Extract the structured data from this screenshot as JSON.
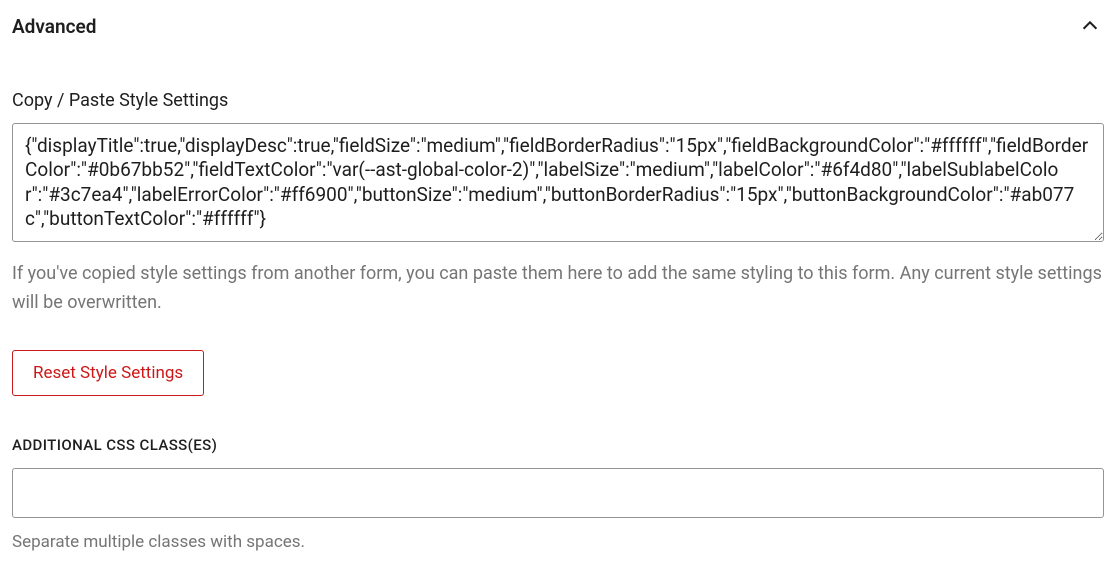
{
  "header": {
    "title": "Advanced"
  },
  "copyPaste": {
    "label": "Copy / Paste Style Settings",
    "value": "{\"displayTitle\":true,\"displayDesc\":true,\"fieldSize\":\"medium\",\"fieldBorderRadius\":\"15px\",\"fieldBackgroundColor\":\"#ffffff\",\"fieldBorderColor\":\"#0b67bb52\",\"fieldTextColor\":\"var(--ast-global-color-2)\",\"labelSize\":\"medium\",\"labelColor\":\"#6f4d80\",\"labelSublabelColor\":\"#3c7ea4\",\"labelErrorColor\":\"#ff6900\",\"buttonSize\":\"medium\",\"buttonBorderRadius\":\"15px\",\"buttonBackgroundColor\":\"#ab077c\",\"buttonTextColor\":\"#ffffff\"}",
    "help": "If you've copied style settings from another form, you can paste them here to add the same styling to this form. Any current style settings will be overwritten."
  },
  "resetButton": {
    "label": "Reset Style Settings"
  },
  "cssClasses": {
    "label": "Additional CSS Class(es)",
    "value": "",
    "help": "Separate multiple classes with spaces."
  }
}
